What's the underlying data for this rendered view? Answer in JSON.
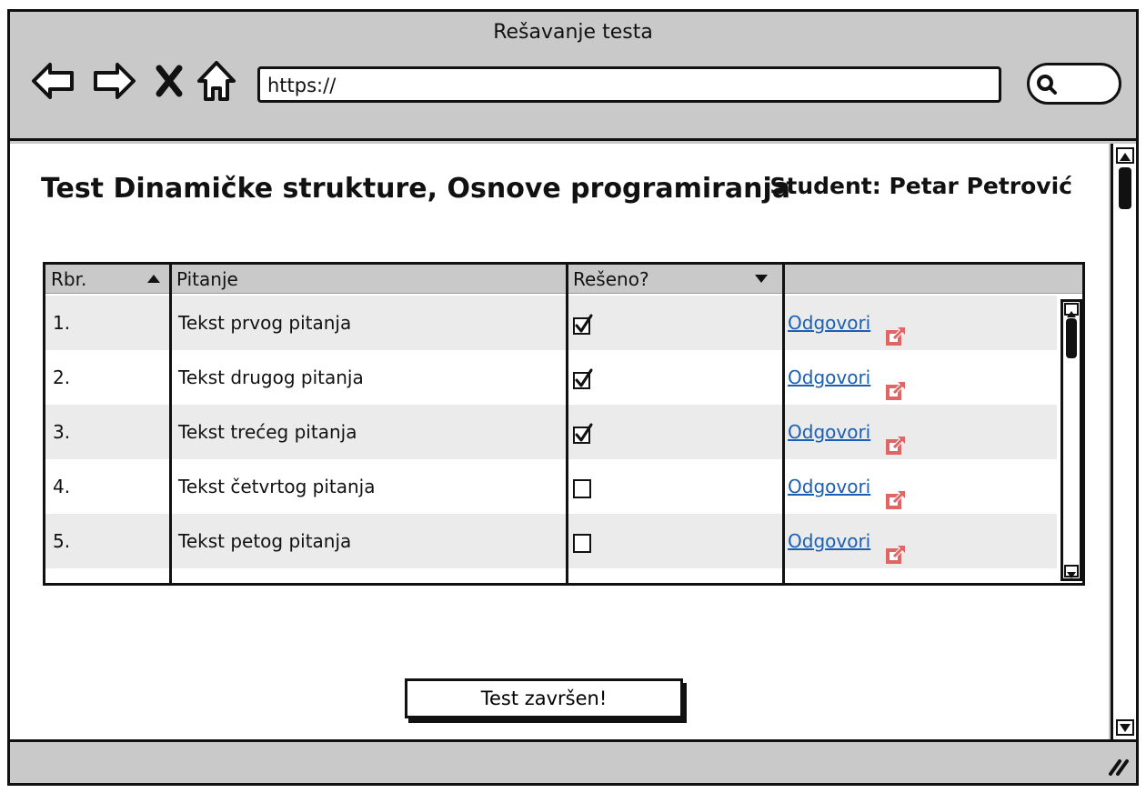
{
  "window": {
    "title": "Rešavanje testa"
  },
  "browser": {
    "url": "https://",
    "nav_icons": [
      "back-arrow-icon",
      "forward-arrow-icon",
      "stop-icon",
      "home-icon"
    ],
    "search_icon": "search-icon"
  },
  "page": {
    "title": "Test Dinamičke strukture, Osnove programiranja",
    "student": "Student: Petar Petrović"
  },
  "table": {
    "headers": {
      "rbr": "Rbr.",
      "pitanje": "Pitanje",
      "reseno": "Rešeno?",
      "action": ""
    },
    "sort": {
      "rbr": "ascending",
      "reseno": "dropdown"
    },
    "rows": [
      {
        "rbr": "1.",
        "pitanje": "Tekst prvog pitanja",
        "reseno": true,
        "link": "Odgovori"
      },
      {
        "rbr": "2.",
        "pitanje": "Tekst drugog pitanja",
        "reseno": true,
        "link": "Odgovori"
      },
      {
        "rbr": "3.",
        "pitanje": "Tekst trećeg pitanja",
        "reseno": true,
        "link": "Odgovori"
      },
      {
        "rbr": "4.",
        "pitanje": "Tekst četvrtog pitanja",
        "reseno": false,
        "link": "Odgovori"
      },
      {
        "rbr": "5.",
        "pitanje": "Tekst petog pitanja",
        "reseno": false,
        "link": "Odgovori"
      }
    ]
  },
  "actions": {
    "finish_label": "Test završen!"
  },
  "colors": {
    "chrome": "#c9c9c9",
    "link": "#1a5fb4",
    "external_icon": "#e06666",
    "alt_row": "#ebebeb"
  }
}
